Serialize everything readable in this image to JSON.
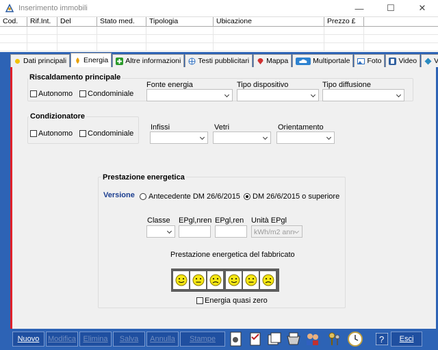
{
  "window": {
    "title": "Inserimento immobili",
    "minimize": "—",
    "maximize": "☐",
    "close": "✕"
  },
  "grid": {
    "columns": [
      "Cod.",
      "Rif.Int.",
      "Del",
      "Stato med.",
      "Tipologia",
      "Ubicazione",
      "Prezzo £"
    ]
  },
  "tabs": [
    {
      "label": "Dati principali",
      "icon": "sun-icon",
      "color": "#f2c200"
    },
    {
      "label": "Energia",
      "icon": "flame-icon",
      "color": "#e8a000"
    },
    {
      "label": "Altre informazioni",
      "icon": "plus-icon",
      "color": "#2a9a2a"
    },
    {
      "label": "Testi pubblicitari",
      "icon": "globe-icon",
      "color": "#3070c0"
    },
    {
      "label": "Mappa",
      "icon": "map-pin-icon",
      "color": "#d03030"
    },
    {
      "label": "Multiportale",
      "icon": "cloud-icon",
      "color": "#2d82d0"
    },
    {
      "label": "Foto",
      "icon": "photo-icon",
      "color": "#3070c0"
    },
    {
      "label": "Video",
      "icon": "film-icon",
      "color": "#3060a0"
    },
    {
      "label": "VT",
      "icon": "compass-icon",
      "color": "#2a8ac0"
    }
  ],
  "heating": {
    "title": "Riscaldamento principale",
    "autonomo": "Autonomo",
    "condominiale": "Condominiale",
    "fonte": "Fonte energia",
    "dispositivo": "Tipo dispositivo",
    "diffusione": "Tipo diffusione"
  },
  "ac": {
    "title": "Condizionatore",
    "autonomo": "Autonomo",
    "condominiale": "Condominiale",
    "infissi": "Infissi",
    "vetri": "Vetri",
    "orientamento": "Orientamento"
  },
  "perf": {
    "title": "Prestazione energetica",
    "versione": "Versione",
    "radio_old": "Antecedente DM 26/6/2015",
    "radio_new": "DM 26/6/2015 o superiore",
    "classe": "Classe",
    "epnren": "EPgl,nren",
    "epren": "EPgl,ren",
    "unita": "Unità EPgl",
    "unita_value": "kWh/m2 anno",
    "fabbricato": "Prestazione energetica del fabbricato",
    "quasi_zero": "Energia quasi zero"
  },
  "buttons": {
    "nuovo": "Nuovo",
    "modifica": "Modifica",
    "elimina": "Elimina",
    "salva": "Salva",
    "annulla": "Annulla",
    "stampe": "Stampe",
    "esci": "Esci"
  },
  "colors": {
    "brand_blue": "#2d63b5",
    "accent_red": "#e0202a",
    "smiley_yellow": "#f5e614"
  }
}
